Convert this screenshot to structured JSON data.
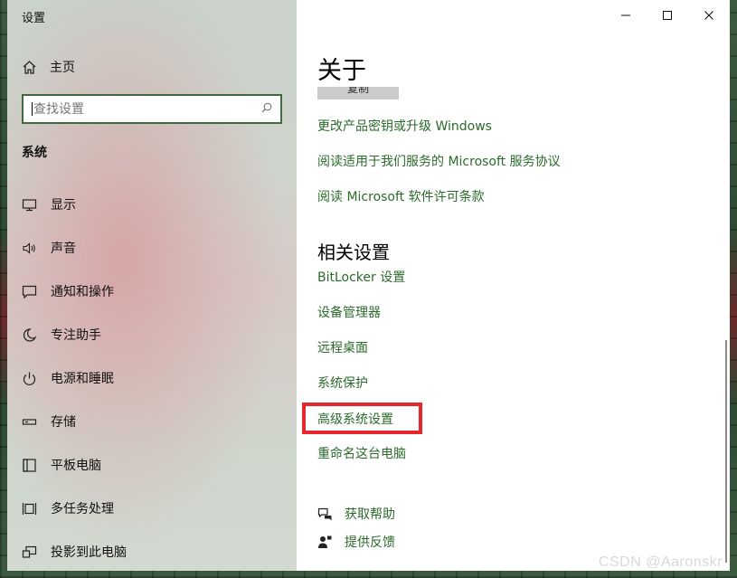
{
  "window": {
    "title": "设置"
  },
  "sidebar": {
    "home_label": "主页",
    "search": {
      "placeholder": "查找设置"
    },
    "section": "系统",
    "items": [
      {
        "label": "显示",
        "icon": "display-icon"
      },
      {
        "label": "声音",
        "icon": "sound-icon"
      },
      {
        "label": "通知和操作",
        "icon": "notification-icon"
      },
      {
        "label": "专注助手",
        "icon": "moon-icon"
      },
      {
        "label": "电源和睡眠",
        "icon": "power-icon"
      },
      {
        "label": "存储",
        "icon": "storage-icon"
      },
      {
        "label": "平板电脑",
        "icon": "tablet-icon"
      },
      {
        "label": "多任务处理",
        "icon": "multitask-icon"
      },
      {
        "label": "投影到此电脑",
        "icon": "project-icon"
      }
    ]
  },
  "content": {
    "title": "关于",
    "partial_button": "复制",
    "links": [
      "更改产品密钥或升级 Windows",
      "阅读适用于我们服务的 Microsoft 服务协议",
      "阅读 Microsoft 软件许可条款"
    ],
    "related_heading": "相关设置",
    "related_links": [
      "BitLocker 设置",
      "设备管理器",
      "远程桌面",
      "系统保护",
      "高级系统设置",
      "重命名这台电脑"
    ],
    "help": [
      {
        "label": "获取帮助",
        "icon": "help-chat-icon"
      },
      {
        "label": "提供反馈",
        "icon": "feedback-icon"
      }
    ]
  },
  "colors": {
    "link": "#2b6a2b",
    "highlight": "#e8262e",
    "search_border": "#3f6a3f"
  },
  "watermark": "CSDN @Aaronskr"
}
